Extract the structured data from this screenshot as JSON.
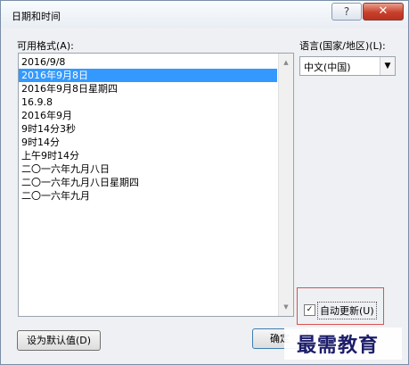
{
  "window": {
    "title": "日期和时间",
    "help_label": "?",
    "close_label": "✕"
  },
  "formats": {
    "label": "可用格式(A):",
    "items": [
      "2016/9/8",
      "2016年9月8日",
      "2016年9月8日星期四",
      "16.9.8",
      "2016年9月",
      "9时14分3秒",
      "9时14分",
      "上午9时14分",
      "二〇一六年九月八日",
      "二〇一六年九月八日星期四",
      "二〇一六年九月"
    ],
    "selected_index": 1,
    "scroll_up": "▲",
    "scroll_down": "▼"
  },
  "language": {
    "label": "语言(国家/地区)(L):",
    "value": "中文(中国)",
    "arrow": "▼"
  },
  "auto_update": {
    "label": "自动更新(U)",
    "checked": true,
    "check_mark": "✓"
  },
  "buttons": {
    "set_default": "设为默认值(D)",
    "ok": "确定"
  },
  "watermark": {
    "text": "最需教育"
  },
  "colors": {
    "selection": "#3399ff",
    "highlight_border": "#d9534f",
    "close_button": "#c8402c"
  }
}
